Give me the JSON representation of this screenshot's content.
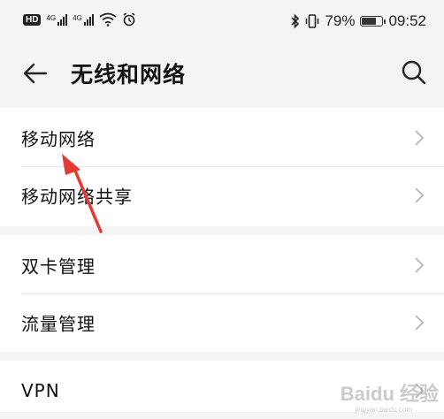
{
  "status_bar": {
    "hd": "HD",
    "network_1": "4G",
    "network_2": "4G",
    "battery_percent": "79%",
    "time": "09:52",
    "battery_level": 0.79
  },
  "app_bar": {
    "title": "无线和网络",
    "back_icon": "arrow-left-icon",
    "search_icon": "search-icon"
  },
  "sections": [
    {
      "items": [
        {
          "label": "移动网络"
        },
        {
          "label": "移动网络共享"
        }
      ]
    },
    {
      "items": [
        {
          "label": "双卡管理"
        },
        {
          "label": "流量管理"
        }
      ]
    },
    {
      "items": [
        {
          "label": "VPN"
        }
      ]
    }
  ],
  "annotation": {
    "color": "#e53935"
  },
  "watermark": {
    "text": "Baidu 经验",
    "url": "jingyan.baidu.com"
  }
}
